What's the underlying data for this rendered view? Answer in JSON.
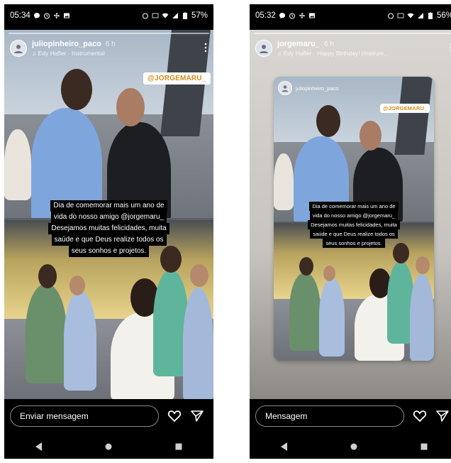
{
  "left": {
    "status": {
      "time": "05:34",
      "battery": "57%"
    },
    "story": {
      "username": "juliopinheiro_paco",
      "time": "6 h",
      "music": "♫ Edy Hafler · Instrumental",
      "tag": "@JORGEMARU_",
      "caption": [
        "Dia de comemorar mais um ano de",
        "vida do nosso amigo @jorgemaru_",
        "Desejamos  muitas felicidades, muita",
        "saúde e que Deus realize todos os",
        "seus sonhos e projetos."
      ]
    },
    "reply": {
      "placeholder": "Enviar mensagem"
    }
  },
  "right": {
    "status": {
      "time": "05:32",
      "battery": "56%"
    },
    "story": {
      "username": "jorgemaru_",
      "time": "6 h",
      "music": "♫ Edy Hafler · Happy Birthday! (Instrum...",
      "card_username": "juliopinheiro_paco",
      "tag": "@JORGEMARU_",
      "caption": [
        "Dia de comemorar mais um ano de",
        "vida do nosso amigo @jorgemaru_",
        "Desejamos  muitas felicidades, muita",
        "saúde e que Deus realize todos os",
        "seus sonhos e projetos."
      ]
    },
    "reply": {
      "placeholder": "Mensagem"
    }
  },
  "icons": {
    "status_left": [
      "facebook-messenger-icon",
      "alarm-icon",
      "fan-icon",
      "gallery-icon"
    ],
    "status_right": [
      "alarm-icon",
      "volte-icon",
      "wifi-icon",
      "signal-icon",
      "battery-icon"
    ],
    "actions": [
      "heart-icon",
      "send-icon"
    ],
    "nav": [
      "back-icon",
      "home-icon",
      "recents-icon"
    ]
  },
  "colors": {
    "tag_text": "#d38b18",
    "caption_bg": "#000000",
    "shirt_blue": "#7fa6dc"
  }
}
